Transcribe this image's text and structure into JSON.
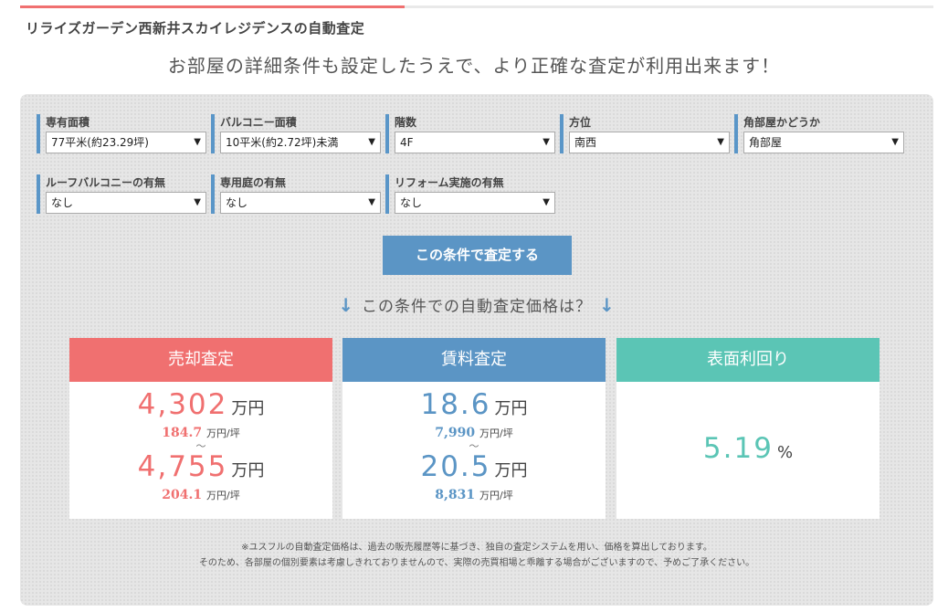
{
  "page": {
    "title": "リライズガーデン西新井スカイレジデンスの自動査定",
    "subtitle": "お部屋の詳細条件も設定したうえで、より正確な査定が利用出来ます！"
  },
  "form": {
    "fields": [
      {
        "label": "専有面積",
        "value": "77平米(約23.29坪)"
      },
      {
        "label": "バルコニー面積",
        "value": "10平米(約2.72坪)未満"
      },
      {
        "label": "階数",
        "value": "4F"
      },
      {
        "label": "方位",
        "value": "南西"
      },
      {
        "label": "角部屋かどうか",
        "value": "角部屋"
      },
      {
        "label": "ルーフバルコニーの有無",
        "value": "なし"
      },
      {
        "label": "専用庭の有無",
        "value": "なし"
      },
      {
        "label": "リフォーム実施の有無",
        "value": "なし"
      }
    ],
    "dropdown_arrow": "▼",
    "submit_label": "この条件で査定する"
  },
  "result": {
    "heading": "この条件での自動査定価格は？",
    "arrow": "↓",
    "tilde": "〜",
    "sale": {
      "title": "売却査定",
      "low": "4,302",
      "low_unit": "万円",
      "low_per": "184.7",
      "per_unit": "万円/坪",
      "high": "4,755",
      "high_unit": "万円",
      "high_per": "204.1"
    },
    "rent": {
      "title": "賃料査定",
      "low": "18.6",
      "low_unit": "万円",
      "low_per": "7,990",
      "per_unit": "万円/坪",
      "high": "20.5",
      "high_unit": "万円",
      "high_per": "8,831"
    },
    "yield": {
      "title": "表面利回り",
      "value": "5.19",
      "unit": "%"
    }
  },
  "note": {
    "line1": "※ユスフルの自動査定価格は、過去の販売履歴等に基づき、独自の査定システムを用い、価格を算出しております。",
    "line2": "そのため、各部屋の個別要素は考慮しきれておりませんので、実際の売買相場と乖離する場合がございますので、予めご了承ください。"
  },
  "colors": {
    "sale": "#f07070",
    "rent": "#5b95c5",
    "yield": "#5bc5b5"
  }
}
